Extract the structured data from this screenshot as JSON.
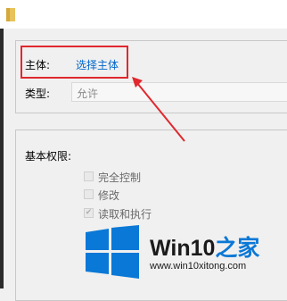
{
  "principal": {
    "label": "主体:",
    "link_text": "选择主体"
  },
  "type": {
    "label": "类型:",
    "value": "允许"
  },
  "basic_permissions": {
    "label": "基本权限:",
    "items": [
      {
        "label": "完全控制",
        "checked": false
      },
      {
        "label": "修改",
        "checked": false
      },
      {
        "label": "读取和执行",
        "checked": true
      }
    ]
  },
  "watermark": {
    "title_main": "Win10",
    "title_accent": "之家",
    "url": "www.win10xitong.com"
  },
  "colors": {
    "link": "#0066cc",
    "highlight": "#e0282e",
    "brand_blue": "#0a78d6"
  },
  "icons": {
    "title": "folder-icon",
    "checkbox": "checkbox-icon",
    "logo": "windows-logo-icon",
    "callout": "arrow-icon"
  }
}
